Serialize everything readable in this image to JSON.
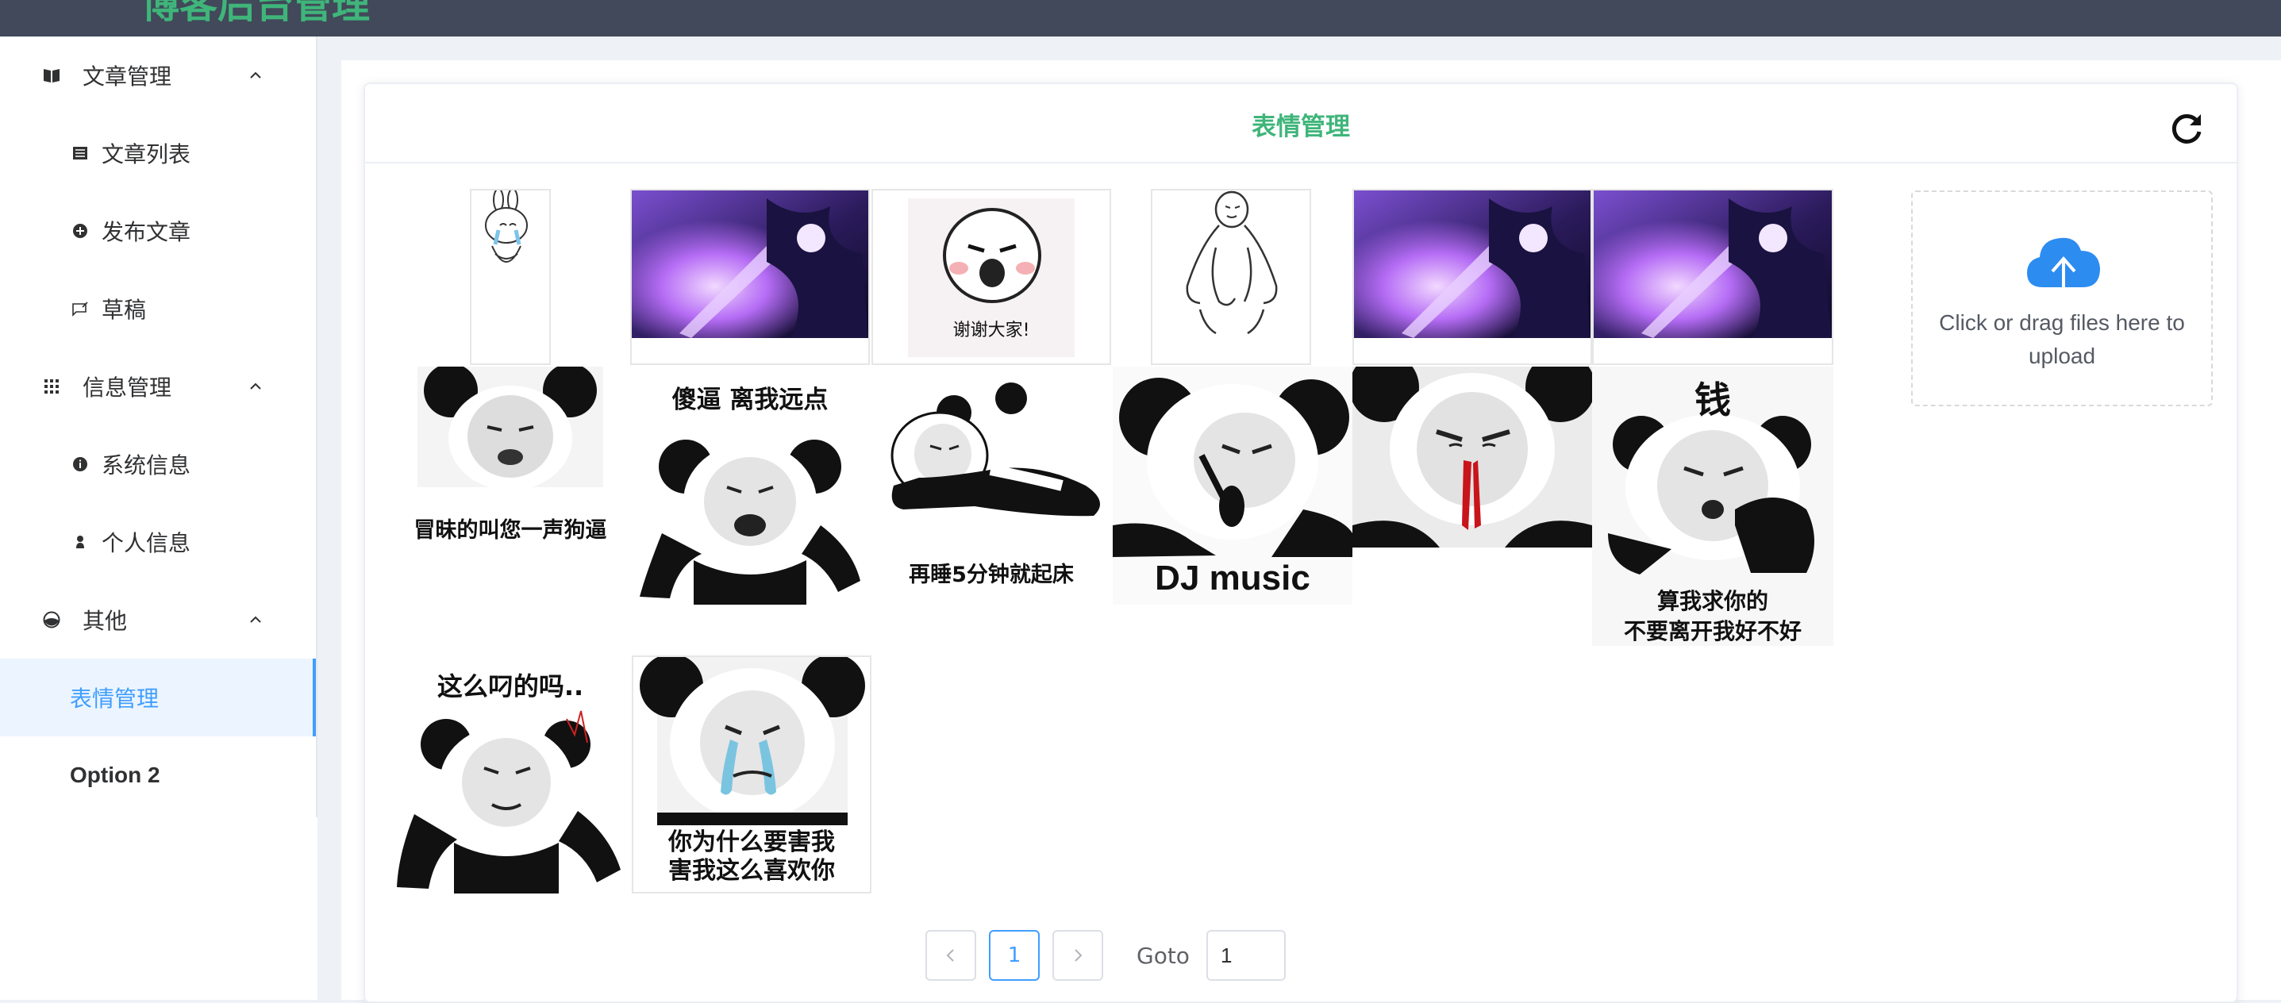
{
  "header": {
    "title": "博客后台管理"
  },
  "sidebar": {
    "groups": [
      {
        "label": "文章管理",
        "icon": "book-icon",
        "items": [
          {
            "label": "文章列表",
            "icon": "list-icon"
          },
          {
            "label": "发布文章",
            "icon": "plus-circle-icon"
          },
          {
            "label": "草稿",
            "icon": "draft-icon"
          }
        ]
      },
      {
        "label": "信息管理",
        "icon": "grid-icon",
        "items": [
          {
            "label": "系统信息",
            "icon": "info-icon"
          },
          {
            "label": "个人信息",
            "icon": "user-icon"
          }
        ]
      },
      {
        "label": "其他",
        "icon": "palette-icon",
        "items": [
          {
            "label": "表情管理",
            "active": true
          },
          {
            "label": "Option 2"
          }
        ]
      }
    ]
  },
  "card": {
    "title": "表情管理",
    "refresh_icon": "refresh-icon"
  },
  "emojis": [
    {
      "type": "bunny-crying"
    },
    {
      "type": "purple-anime"
    },
    {
      "type": "meme-face",
      "caption": "谢谢大家!"
    },
    {
      "type": "stick-figure"
    },
    {
      "type": "purple-anime"
    },
    {
      "type": "purple-anime"
    },
    {
      "type": "panda-meme",
      "caption": "冒昧的叫您一声狗逼"
    },
    {
      "type": "panda-meme",
      "caption": "傻逼 离我远点"
    },
    {
      "type": "panda-meme",
      "caption": "再睡5分钟就起床"
    },
    {
      "type": "panda-meme",
      "caption": "DJ music"
    },
    {
      "type": "panda-meme"
    },
    {
      "type": "panda-meme",
      "caption_top": "钱",
      "caption_lines": [
        "算我求你的",
        "不要离开我好不好"
      ]
    },
    {
      "type": "panda-meme",
      "caption": "这么叼的吗.."
    },
    {
      "type": "panda-meme",
      "caption_lines": [
        "你为什么要害我",
        "害我这么喜欢你"
      ]
    }
  ],
  "upload": {
    "text": "Click or drag files here to upload",
    "icon": "cloud-upload-icon",
    "accent": "#2d8cf0"
  },
  "pagination": {
    "prev_icon": "chevron-left-icon",
    "next_icon": "chevron-right-icon",
    "current_page": "1",
    "goto_label": "Goto",
    "goto_value": "1"
  },
  "colors": {
    "accent_green": "#3fb57a",
    "active_blue": "#409eff",
    "topbar": "#41495a"
  }
}
